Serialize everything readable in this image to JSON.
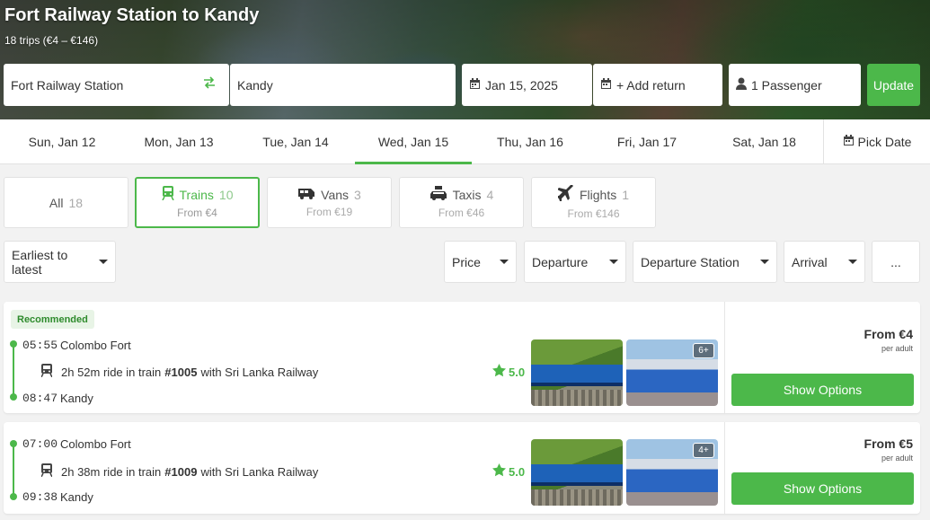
{
  "header": {
    "title": "Fort Railway Station to Kandy",
    "subtitle": "18 trips (€4 – €146)"
  },
  "search": {
    "from": "Fort Railway Station",
    "to": "Kandy",
    "date": "Jan 15, 2025",
    "return_label": "+ Add return",
    "passengers": "1 Passenger",
    "update_label": "Update"
  },
  "date_tabs": [
    {
      "label": "Sun, Jan 12"
    },
    {
      "label": "Mon, Jan 13"
    },
    {
      "label": "Tue, Jan 14"
    },
    {
      "label": "Wed, Jan 15",
      "active": true
    },
    {
      "label": "Thu, Jan 16"
    },
    {
      "label": "Fri, Jan 17"
    },
    {
      "label": "Sat, Jan 18"
    }
  ],
  "pick_date_label": "Pick Date",
  "categories": [
    {
      "label": "All",
      "count": "18",
      "from": ""
    },
    {
      "label": "Trains",
      "count": "10",
      "from": "From €4",
      "active": true
    },
    {
      "label": "Vans",
      "count": "3",
      "from": "From €19"
    },
    {
      "label": "Taxis",
      "count": "4",
      "from": "From €46"
    },
    {
      "label": "Flights",
      "count": "1",
      "from": "From €146"
    }
  ],
  "filters": {
    "sort": "Earliest to latest",
    "price": "Price",
    "departure": "Departure",
    "departure_station": "Departure Station",
    "arrival": "Arrival",
    "more": "..."
  },
  "trips": [
    {
      "badge": "Recommended",
      "depart_time": "05:55",
      "depart_station": "Colombo Fort",
      "ride_prefix": "2h 52m ride in train",
      "train_number": "#1005",
      "ride_suffix": "with Sri Lanka Railway",
      "arrive_time": "08:47",
      "arrive_station": "Kandy",
      "rating": "5.0",
      "photo_count": "6+",
      "price": "From €4",
      "per": "per adult",
      "button": "Show Options"
    },
    {
      "badge": "",
      "depart_time": "07:00",
      "depart_station": "Colombo Fort",
      "ride_prefix": "2h 38m ride in train",
      "train_number": "#1009",
      "ride_suffix": "with Sri Lanka Railway",
      "arrive_time": "09:38",
      "arrive_station": "Kandy",
      "rating": "5.0",
      "photo_count": "4+",
      "price": "From €5",
      "per": "per adult",
      "button": "Show Options"
    }
  ],
  "colors": {
    "accent": "#4cb84a",
    "badge_bg": "#e8f4e6",
    "badge_text": "#2e8b2c"
  }
}
